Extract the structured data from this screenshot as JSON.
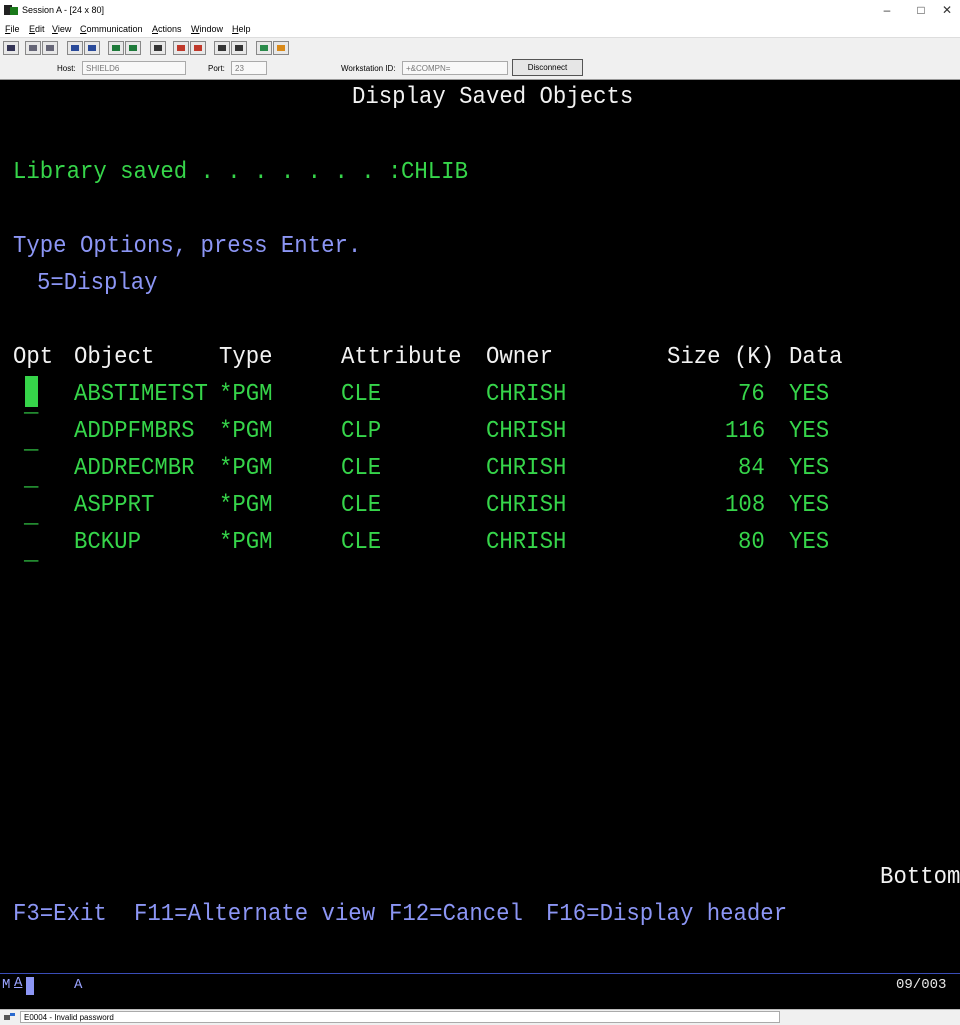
{
  "window": {
    "title": "Session A - [24 x 80]"
  },
  "menu": [
    {
      "pre": "",
      "u": "F",
      "post": "ile"
    },
    {
      "pre": "",
      "u": "E",
      "post": "dit"
    },
    {
      "pre": "",
      "u": "V",
      "post": "iew"
    },
    {
      "pre": "",
      "u": "C",
      "post": "ommunication"
    },
    {
      "pre": "",
      "u": "A",
      "post": "ctions"
    },
    {
      "pre": "",
      "u": "W",
      "post": "indow"
    },
    {
      "pre": "",
      "u": "H",
      "post": "elp"
    }
  ],
  "connection": {
    "host_label": "Host:",
    "host_value": "SHIELD6",
    "port_label": "Port:",
    "port_value": "23",
    "workstation_label": "Workstation ID:",
    "workstation_value": "+&COMPN=",
    "disconnect_label": "Disconnect"
  },
  "screen": {
    "title": "Display Saved Objects",
    "library_label": "Library saved . . . . . . . :",
    "library_value": "CHLIB",
    "instructions": "Type Options, press Enter.",
    "option": "5=Display",
    "columns": {
      "opt": "Opt",
      "object": "Object",
      "type": "Type",
      "attribute": "Attribute",
      "owner": "Owner",
      "size": "Size (K)",
      "data": "Data"
    },
    "rows": [
      {
        "object": "ABSTIMETST",
        "type": "*PGM",
        "attribute": "CLE",
        "owner": "CHRISH",
        "size": "76",
        "data": "YES"
      },
      {
        "object": "ADDPFMBRS",
        "type": "*PGM",
        "attribute": "CLP",
        "owner": "CHRISH",
        "size": "116",
        "data": "YES"
      },
      {
        "object": "ADDRECMBR",
        "type": "*PGM",
        "attribute": "CLE",
        "owner": "CHRISH",
        "size": "84",
        "data": "YES"
      },
      {
        "object": "ASPPRT",
        "type": "*PGM",
        "attribute": "CLE",
        "owner": "CHRISH",
        "size": "108",
        "data": "YES"
      },
      {
        "object": "BCKUP",
        "type": "*PGM",
        "attribute": "CLE",
        "owner": "CHRISH",
        "size": "80",
        "data": "YES"
      }
    ],
    "more": "Bottom",
    "function_keys": [
      "F3=Exit",
      "F11=Alternate view",
      "F12=Cancel",
      "F16=Display header"
    ]
  },
  "oia": {
    "indicator_m": "M",
    "indicator_a": "A",
    "indicator_a2": "A",
    "cursor_pos": "09/003"
  },
  "status": {
    "message": "E0004 - Invalid password"
  },
  "colors": {
    "terminal_bg": "#000000",
    "field_green": "#36d54a",
    "text_blue": "#8c96f5",
    "text_white": "#f2f2f2"
  }
}
